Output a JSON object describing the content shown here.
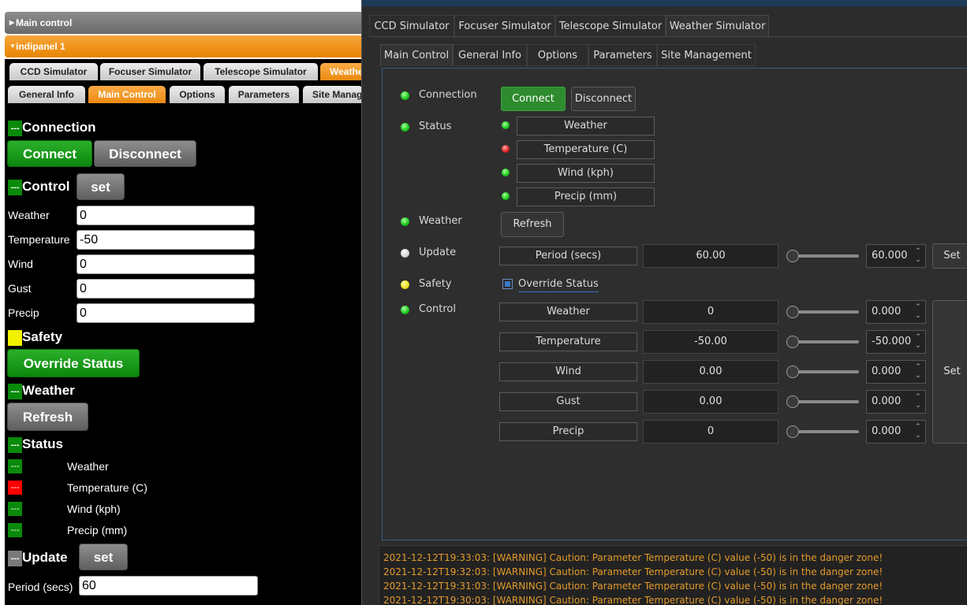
{
  "left": {
    "accordion": {
      "main_control": "Main control",
      "panel": "indipanel 1"
    },
    "device_tabs": [
      "CCD Simulator",
      "Focuser Simulator",
      "Telescope Simulator",
      "Weathe"
    ],
    "group_tabs": [
      "General Info",
      "Main Control",
      "Options",
      "Parameters",
      "Site Manag"
    ],
    "sections": {
      "connection": "Connection",
      "control": "Control",
      "safety": "Safety",
      "weather": "Weather",
      "status": "Status",
      "update": "Update"
    },
    "marker": "---",
    "buttons": {
      "connect": "Connect",
      "disconnect": "Disconnect",
      "set": "set",
      "override": "Override Status",
      "refresh": "Refresh",
      "update_set": "set"
    },
    "control_fields": [
      {
        "label": "Weather",
        "value": "0"
      },
      {
        "label": "Temperature",
        "value": "-50"
      },
      {
        "label": "Wind",
        "value": "0"
      },
      {
        "label": "Gust",
        "value": "0"
      },
      {
        "label": "Precip",
        "value": "0"
      }
    ],
    "status_items": [
      {
        "label": "Weather",
        "color": "#0a8a0a"
      },
      {
        "label": "Temperature (C)",
        "color": "#ff0000"
      },
      {
        "label": "Wind (kph)",
        "color": "#0a8a0a"
      },
      {
        "label": "Precip (mm)",
        "color": "#0a8a0a"
      }
    ],
    "period": {
      "label": "Period (secs)",
      "value": "60"
    }
  },
  "right": {
    "device_tabs": [
      "CCD Simulator",
      "Focuser Simulator",
      "Telescope Simulator",
      "Weather Simulator"
    ],
    "group_tabs": [
      "Main Control",
      "General Info",
      "Options",
      "Parameters",
      "Site Management"
    ],
    "connection": {
      "label": "Connection",
      "connect": "Connect",
      "disconnect": "Disconnect"
    },
    "status": {
      "label": "Status",
      "items": [
        "Weather",
        "Temperature (C)",
        "Wind (kph)",
        "Precip (mm)"
      ]
    },
    "weather": {
      "label": "Weather",
      "refresh": "Refresh"
    },
    "update": {
      "label": "Update",
      "name": "Period (secs)",
      "value": "60.00",
      "spin": "60.000",
      "set": "Set"
    },
    "safety": {
      "label": "Safety",
      "override": "Override Status"
    },
    "control": {
      "label": "Control",
      "set": "Set",
      "rows": [
        {
          "name": "Weather",
          "value": "0",
          "spin": "0.000"
        },
        {
          "name": "Temperature",
          "value": "-50.00",
          "spin": "-50.000"
        },
        {
          "name": "Wind",
          "value": "0.00",
          "spin": "0.000"
        },
        {
          "name": "Gust",
          "value": "0.00",
          "spin": "0.000"
        },
        {
          "name": "Precip",
          "value": "0",
          "spin": "0.000"
        }
      ]
    },
    "log": [
      "2021-12-12T19:33:03: [WARNING] Caution: Parameter Temperature (C) value (-50) is in the danger zone!",
      "2021-12-12T19:32:03: [WARNING] Caution: Parameter Temperature (C) value (-50) is in the danger zone!",
      "2021-12-12T19:31:03: [WARNING] Caution: Parameter Temperature (C) value (-50) is in the danger zone!",
      "2021-12-12T19:30:03: [WARNING] Caution: Parameter Temperature (C) value (-50) is in the danger zone!"
    ]
  }
}
